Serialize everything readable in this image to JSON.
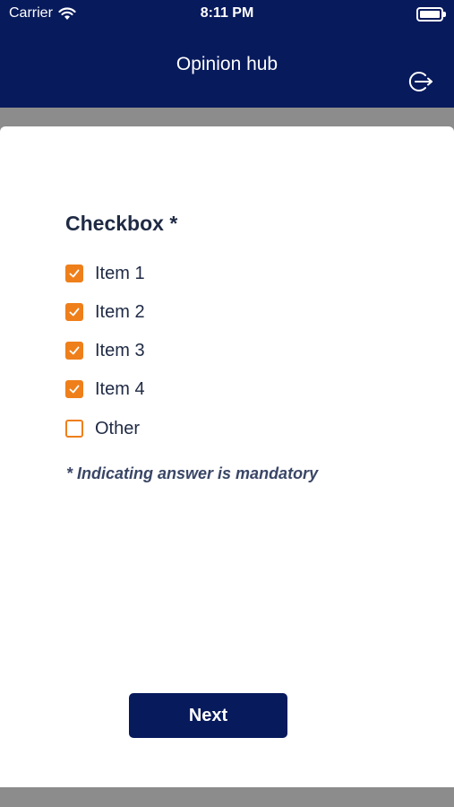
{
  "status_bar": {
    "carrier": "Carrier",
    "time": "8:11 PM",
    "wifi_icon": "wifi-icon",
    "battery_icon": "battery-full-icon"
  },
  "nav": {
    "title": "Opinion hub",
    "logout_icon": "logout-icon"
  },
  "question": {
    "title": "Checkbox *",
    "options": [
      {
        "label": "Item 1",
        "checked": true
      },
      {
        "label": "Item 2",
        "checked": true
      },
      {
        "label": "Item 3",
        "checked": true
      },
      {
        "label": "Item 4",
        "checked": true
      },
      {
        "label": "Other",
        "checked": false
      }
    ],
    "note": "* Indicating answer is mandatory"
  },
  "footer": {
    "next_label": "Next"
  },
  "colors": {
    "header": "#071a5c",
    "checkbox": "#ef7f1a",
    "text": "#1f2a44",
    "backdrop": "#8c8c8c"
  }
}
